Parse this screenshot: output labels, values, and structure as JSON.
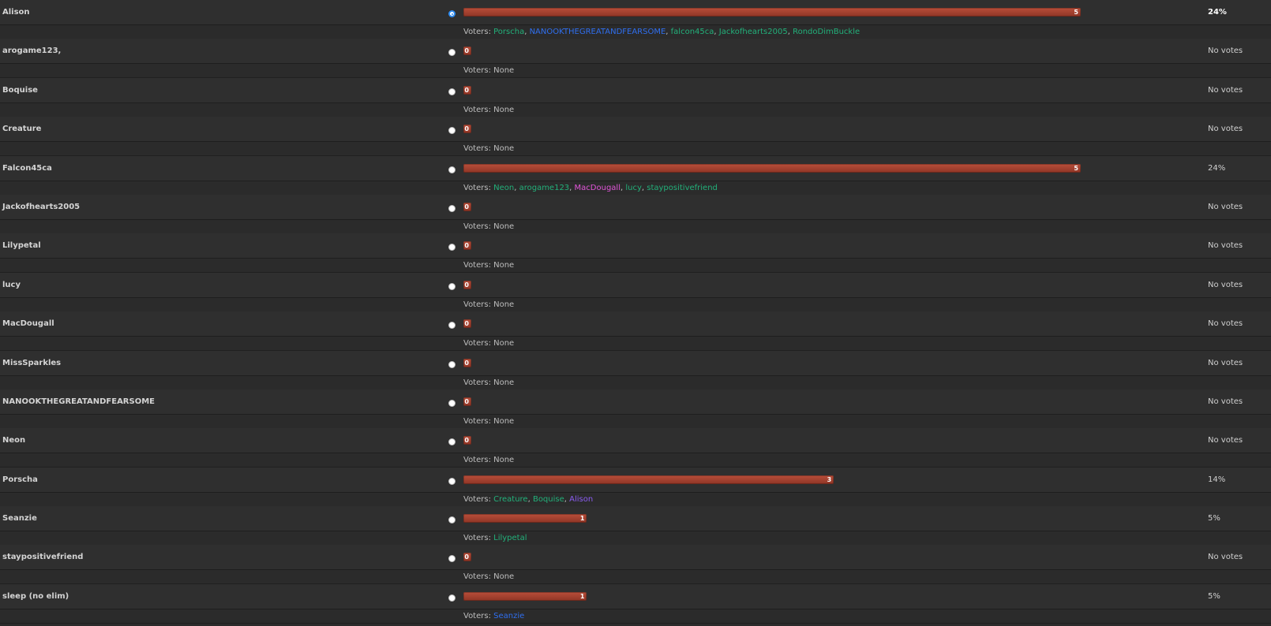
{
  "voters_label": "Voters: ",
  "none_label": "None",
  "max_votes": 5,
  "colors": {
    "bar": "#a8442f",
    "voter_default": "#22b07a",
    "voter_blue": "#2f6ff0",
    "voter_pink": "#e055d8",
    "voter_purple": "#8a5cf0"
  },
  "options": [
    {
      "label": "Alison",
      "votes": 5,
      "votes_text": "5",
      "pct": "24%",
      "top": true,
      "selected": true,
      "voters": [
        {
          "name": "Porscha",
          "color": "#22b07a"
        },
        {
          "name": "NANOOKTHEGREATANDFEARSOME",
          "color": "#2f6ff0"
        },
        {
          "name": "falcon45ca",
          "color": "#22b07a"
        },
        {
          "name": "Jackofhearts2005",
          "color": "#22b07a"
        },
        {
          "name": "RondoDimBuckle",
          "color": "#22b07a"
        }
      ]
    },
    {
      "label": "arogame123,",
      "votes": 0,
      "votes_text": "0",
      "pct": "No votes",
      "voters": []
    },
    {
      "label": "Boquise",
      "votes": 0,
      "votes_text": "0",
      "pct": "No votes",
      "voters": []
    },
    {
      "label": "Creature",
      "votes": 0,
      "votes_text": "0",
      "pct": "No votes",
      "voters": []
    },
    {
      "label": "Falcon45ca",
      "votes": 5,
      "votes_text": "5",
      "pct": "24%",
      "voters": [
        {
          "name": "Neon",
          "color": "#22b07a"
        },
        {
          "name": "arogame123",
          "color": "#22b07a"
        },
        {
          "name": "MacDougall",
          "color": "#e055d8"
        },
        {
          "name": "lucy",
          "color": "#22b07a"
        },
        {
          "name": "staypositivefriend",
          "color": "#22b07a"
        }
      ]
    },
    {
      "label": "Jackofhearts2005",
      "votes": 0,
      "votes_text": "0",
      "pct": "No votes",
      "voters": []
    },
    {
      "label": "Lilypetal",
      "votes": 0,
      "votes_text": "0",
      "pct": "No votes",
      "voters": []
    },
    {
      "label": "lucy",
      "votes": 0,
      "votes_text": "0",
      "pct": "No votes",
      "voters": []
    },
    {
      "label": "MacDougall",
      "votes": 0,
      "votes_text": "0",
      "pct": "No votes",
      "voters": []
    },
    {
      "label": "MissSparkles",
      "votes": 0,
      "votes_text": "0",
      "pct": "No votes",
      "voters": []
    },
    {
      "label": "NANOOKTHEGREATANDFEARSOME",
      "votes": 0,
      "votes_text": "0",
      "pct": "No votes",
      "voters": []
    },
    {
      "label": "Neon",
      "votes": 0,
      "votes_text": "0",
      "pct": "No votes",
      "voters": []
    },
    {
      "label": "Porscha",
      "votes": 3,
      "votes_text": "3",
      "pct": "14%",
      "voters": [
        {
          "name": "Creature",
          "color": "#22b07a"
        },
        {
          "name": "Boquise",
          "color": "#22b07a"
        },
        {
          "name": "Alison",
          "color": "#8a5cf0"
        }
      ]
    },
    {
      "label": "Seanzie",
      "votes": 1,
      "votes_text": "1",
      "pct": "5%",
      "voters": [
        {
          "name": "Lilypetal",
          "color": "#22b07a"
        }
      ]
    },
    {
      "label": "staypositivefriend",
      "votes": 0,
      "votes_text": "0",
      "pct": "No votes",
      "voters": []
    },
    {
      "label": "sleep (no elim)",
      "votes": 1,
      "votes_text": "1",
      "pct": "5%",
      "voters": [
        {
          "name": "Seanzie",
          "color": "#2f6ff0"
        }
      ]
    }
  ]
}
